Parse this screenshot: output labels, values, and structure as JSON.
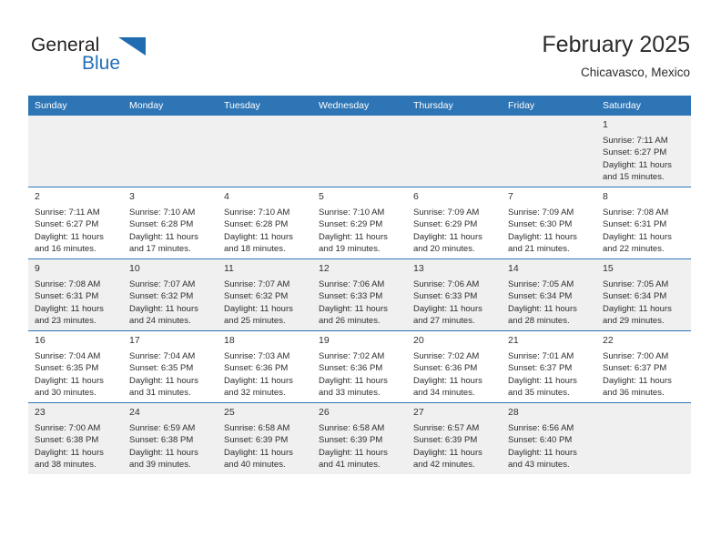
{
  "brand": {
    "word_one": "General",
    "word_two": "Blue",
    "triangle_icon": "triangle-icon",
    "accent_color": "#2271b6"
  },
  "header": {
    "title": "February 2025",
    "subtitle": "Chicavasco, Mexico"
  },
  "calendar": {
    "header_bg": "#2e75b6",
    "row_shade": "#f0f0f0",
    "weekdays": [
      "Sunday",
      "Monday",
      "Tuesday",
      "Wednesday",
      "Thursday",
      "Friday",
      "Saturday"
    ],
    "weeks": [
      [
        {
          "day": "",
          "sunrise": "",
          "sunset": "",
          "daylight_line1": "",
          "daylight_line2": ""
        },
        {
          "day": "",
          "sunrise": "",
          "sunset": "",
          "daylight_line1": "",
          "daylight_line2": ""
        },
        {
          "day": "",
          "sunrise": "",
          "sunset": "",
          "daylight_line1": "",
          "daylight_line2": ""
        },
        {
          "day": "",
          "sunrise": "",
          "sunset": "",
          "daylight_line1": "",
          "daylight_line2": ""
        },
        {
          "day": "",
          "sunrise": "",
          "sunset": "",
          "daylight_line1": "",
          "daylight_line2": ""
        },
        {
          "day": "",
          "sunrise": "",
          "sunset": "",
          "daylight_line1": "",
          "daylight_line2": ""
        },
        {
          "day": "1",
          "sunrise": "Sunrise: 7:11 AM",
          "sunset": "Sunset: 6:27 PM",
          "daylight_line1": "Daylight: 11 hours",
          "daylight_line2": "and 15 minutes."
        }
      ],
      [
        {
          "day": "2",
          "sunrise": "Sunrise: 7:11 AM",
          "sunset": "Sunset: 6:27 PM",
          "daylight_line1": "Daylight: 11 hours",
          "daylight_line2": "and 16 minutes."
        },
        {
          "day": "3",
          "sunrise": "Sunrise: 7:10 AM",
          "sunset": "Sunset: 6:28 PM",
          "daylight_line1": "Daylight: 11 hours",
          "daylight_line2": "and 17 minutes."
        },
        {
          "day": "4",
          "sunrise": "Sunrise: 7:10 AM",
          "sunset": "Sunset: 6:28 PM",
          "daylight_line1": "Daylight: 11 hours",
          "daylight_line2": "and 18 minutes."
        },
        {
          "day": "5",
          "sunrise": "Sunrise: 7:10 AM",
          "sunset": "Sunset: 6:29 PM",
          "daylight_line1": "Daylight: 11 hours",
          "daylight_line2": "and 19 minutes."
        },
        {
          "day": "6",
          "sunrise": "Sunrise: 7:09 AM",
          "sunset": "Sunset: 6:29 PM",
          "daylight_line1": "Daylight: 11 hours",
          "daylight_line2": "and 20 minutes."
        },
        {
          "day": "7",
          "sunrise": "Sunrise: 7:09 AM",
          "sunset": "Sunset: 6:30 PM",
          "daylight_line1": "Daylight: 11 hours",
          "daylight_line2": "and 21 minutes."
        },
        {
          "day": "8",
          "sunrise": "Sunrise: 7:08 AM",
          "sunset": "Sunset: 6:31 PM",
          "daylight_line1": "Daylight: 11 hours",
          "daylight_line2": "and 22 minutes."
        }
      ],
      [
        {
          "day": "9",
          "sunrise": "Sunrise: 7:08 AM",
          "sunset": "Sunset: 6:31 PM",
          "daylight_line1": "Daylight: 11 hours",
          "daylight_line2": "and 23 minutes."
        },
        {
          "day": "10",
          "sunrise": "Sunrise: 7:07 AM",
          "sunset": "Sunset: 6:32 PM",
          "daylight_line1": "Daylight: 11 hours",
          "daylight_line2": "and 24 minutes."
        },
        {
          "day": "11",
          "sunrise": "Sunrise: 7:07 AM",
          "sunset": "Sunset: 6:32 PM",
          "daylight_line1": "Daylight: 11 hours",
          "daylight_line2": "and 25 minutes."
        },
        {
          "day": "12",
          "sunrise": "Sunrise: 7:06 AM",
          "sunset": "Sunset: 6:33 PM",
          "daylight_line1": "Daylight: 11 hours",
          "daylight_line2": "and 26 minutes."
        },
        {
          "day": "13",
          "sunrise": "Sunrise: 7:06 AM",
          "sunset": "Sunset: 6:33 PM",
          "daylight_line1": "Daylight: 11 hours",
          "daylight_line2": "and 27 minutes."
        },
        {
          "day": "14",
          "sunrise": "Sunrise: 7:05 AM",
          "sunset": "Sunset: 6:34 PM",
          "daylight_line1": "Daylight: 11 hours",
          "daylight_line2": "and 28 minutes."
        },
        {
          "day": "15",
          "sunrise": "Sunrise: 7:05 AM",
          "sunset": "Sunset: 6:34 PM",
          "daylight_line1": "Daylight: 11 hours",
          "daylight_line2": "and 29 minutes."
        }
      ],
      [
        {
          "day": "16",
          "sunrise": "Sunrise: 7:04 AM",
          "sunset": "Sunset: 6:35 PM",
          "daylight_line1": "Daylight: 11 hours",
          "daylight_line2": "and 30 minutes."
        },
        {
          "day": "17",
          "sunrise": "Sunrise: 7:04 AM",
          "sunset": "Sunset: 6:35 PM",
          "daylight_line1": "Daylight: 11 hours",
          "daylight_line2": "and 31 minutes."
        },
        {
          "day": "18",
          "sunrise": "Sunrise: 7:03 AM",
          "sunset": "Sunset: 6:36 PM",
          "daylight_line1": "Daylight: 11 hours",
          "daylight_line2": "and 32 minutes."
        },
        {
          "day": "19",
          "sunrise": "Sunrise: 7:02 AM",
          "sunset": "Sunset: 6:36 PM",
          "daylight_line1": "Daylight: 11 hours",
          "daylight_line2": "and 33 minutes."
        },
        {
          "day": "20",
          "sunrise": "Sunrise: 7:02 AM",
          "sunset": "Sunset: 6:36 PM",
          "daylight_line1": "Daylight: 11 hours",
          "daylight_line2": "and 34 minutes."
        },
        {
          "day": "21",
          "sunrise": "Sunrise: 7:01 AM",
          "sunset": "Sunset: 6:37 PM",
          "daylight_line1": "Daylight: 11 hours",
          "daylight_line2": "and 35 minutes."
        },
        {
          "day": "22",
          "sunrise": "Sunrise: 7:00 AM",
          "sunset": "Sunset: 6:37 PM",
          "daylight_line1": "Daylight: 11 hours",
          "daylight_line2": "and 36 minutes."
        }
      ],
      [
        {
          "day": "23",
          "sunrise": "Sunrise: 7:00 AM",
          "sunset": "Sunset: 6:38 PM",
          "daylight_line1": "Daylight: 11 hours",
          "daylight_line2": "and 38 minutes."
        },
        {
          "day": "24",
          "sunrise": "Sunrise: 6:59 AM",
          "sunset": "Sunset: 6:38 PM",
          "daylight_line1": "Daylight: 11 hours",
          "daylight_line2": "and 39 minutes."
        },
        {
          "day": "25",
          "sunrise": "Sunrise: 6:58 AM",
          "sunset": "Sunset: 6:39 PM",
          "daylight_line1": "Daylight: 11 hours",
          "daylight_line2": "and 40 minutes."
        },
        {
          "day": "26",
          "sunrise": "Sunrise: 6:58 AM",
          "sunset": "Sunset: 6:39 PM",
          "daylight_line1": "Daylight: 11 hours",
          "daylight_line2": "and 41 minutes."
        },
        {
          "day": "27",
          "sunrise": "Sunrise: 6:57 AM",
          "sunset": "Sunset: 6:39 PM",
          "daylight_line1": "Daylight: 11 hours",
          "daylight_line2": "and 42 minutes."
        },
        {
          "day": "28",
          "sunrise": "Sunrise: 6:56 AM",
          "sunset": "Sunset: 6:40 PM",
          "daylight_line1": "Daylight: 11 hours",
          "daylight_line2": "and 43 minutes."
        },
        {
          "day": "",
          "sunrise": "",
          "sunset": "",
          "daylight_line1": "",
          "daylight_line2": ""
        }
      ]
    ]
  }
}
